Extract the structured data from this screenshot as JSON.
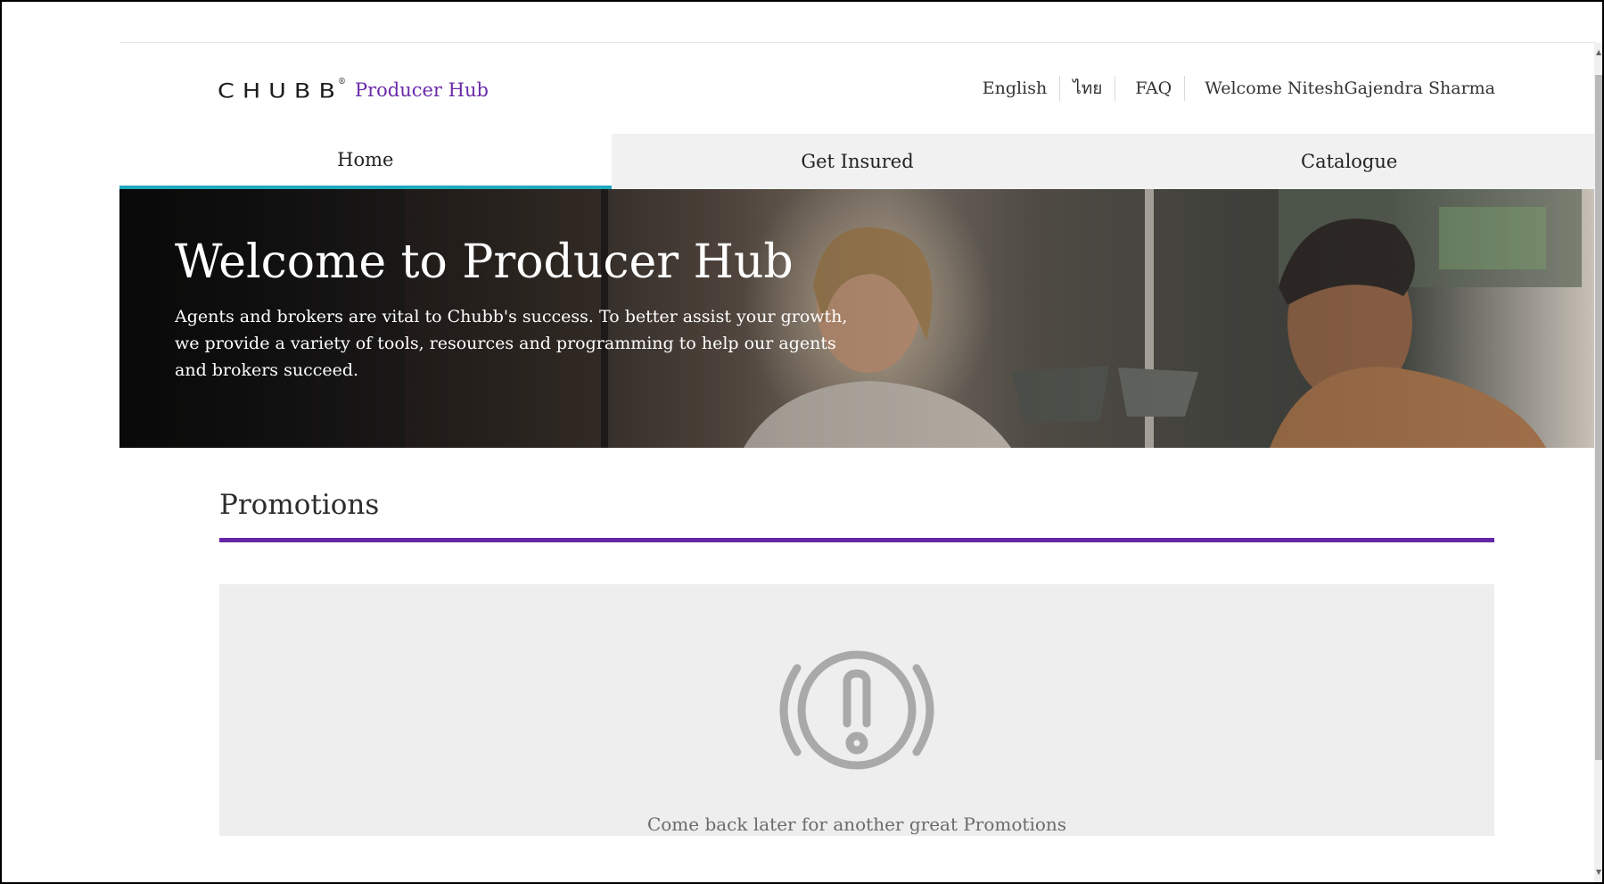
{
  "brand": {
    "logo_text": "CHUBB",
    "logo_mark": "®",
    "product_name": "Producer Hub"
  },
  "utility_nav": {
    "english": "English",
    "thai": "ไทย",
    "faq": "FAQ",
    "welcome": "Welcome NiteshGajendra Sharma"
  },
  "tabs": [
    {
      "label": "Home",
      "active": true
    },
    {
      "label": "Get Insured",
      "active": false
    },
    {
      "label": "Catalogue",
      "active": false
    }
  ],
  "hero": {
    "title": "Welcome to Producer Hub",
    "text": "Agents and brokers are vital to Chubb's success. To better assist your growth, we provide a variety of tools, resources and programming to help our agents and brokers succeed."
  },
  "promotions": {
    "heading": "Promotions",
    "empty_message": "Come back later for another great Promotions",
    "empty_icon": "alert-icon"
  },
  "colors": {
    "brand_purple": "#6426a6",
    "active_tab_accent": "#1ea9bd",
    "tab_inactive_bg": "#f1f1f1",
    "promo_box_bg": "#eeeeee"
  }
}
